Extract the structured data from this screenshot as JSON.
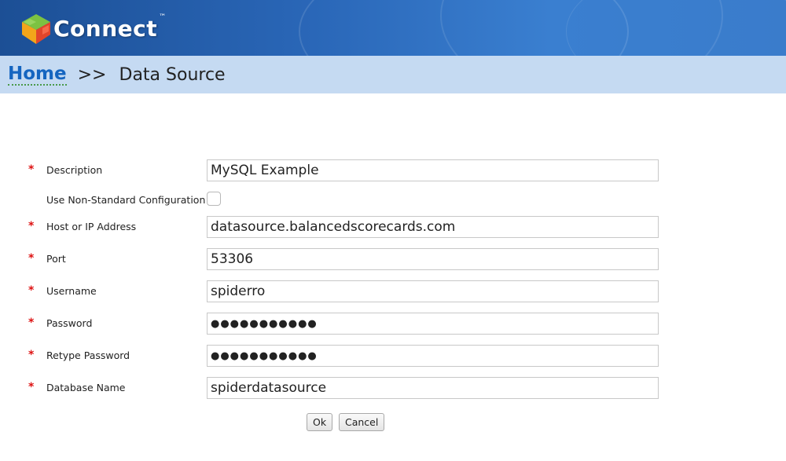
{
  "app": {
    "logo_text": "Connect",
    "trademark": "™"
  },
  "breadcrumb": {
    "home": "Home",
    "separator": ">>",
    "current": "Data Source"
  },
  "form": {
    "required_mark": "*",
    "description": {
      "label": "Description",
      "value": "MySQL Example",
      "required": true
    },
    "non_standard": {
      "label": "Use Non-Standard Configuration",
      "checked": false,
      "required": false
    },
    "host": {
      "label": "Host or IP Address",
      "value": "datasource.balancedscorecards.com",
      "required": true
    },
    "port": {
      "label": "Port",
      "value": "53306",
      "required": true
    },
    "username": {
      "label": "Username",
      "value": "spiderro",
      "required": true
    },
    "password": {
      "label": "Password",
      "value": "●●●●●●●●●●●",
      "required": true
    },
    "retype_password": {
      "label": "Retype Password",
      "value": "●●●●●●●●●●●",
      "required": true
    },
    "database_name": {
      "label": "Database Name",
      "value": "spiderdatasource",
      "required": true
    }
  },
  "buttons": {
    "ok": "Ok",
    "cancel": "Cancel"
  },
  "colors": {
    "banner": "#2a67b8",
    "crumbbar": "#c5daf2",
    "link": "#1565c0",
    "required": "#dd1111"
  }
}
